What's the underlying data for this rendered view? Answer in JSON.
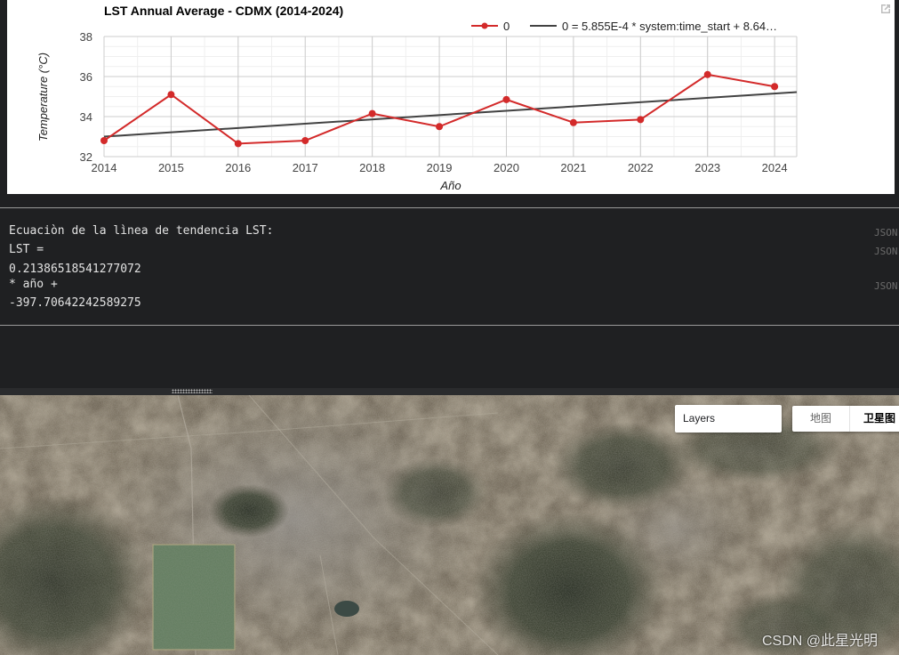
{
  "chart_data": {
    "type": "line",
    "title": "LST Annual Average - CDMX (2014-2024)",
    "xlabel": "Año",
    "ylabel": "Temperature (°C)",
    "x": [
      2014,
      2015,
      2016,
      2017,
      2018,
      2019,
      2020,
      2021,
      2022,
      2023,
      2024
    ],
    "xticks": [
      "2014",
      "2015",
      "2016",
      "2017",
      "2018",
      "2019",
      "2020",
      "2021",
      "2022",
      "2023",
      "2024"
    ],
    "yticks": [
      "32",
      "34",
      "36",
      "38"
    ],
    "ylim": [
      32,
      38
    ],
    "xlim": [
      2014,
      2024.33
    ],
    "grid": true,
    "legend_position": "top-right",
    "series": [
      {
        "name": "0",
        "values": [
          32.8,
          35.1,
          32.65,
          32.8,
          34.15,
          33.5,
          34.85,
          33.7,
          33.85,
          36.1,
          35.5
        ],
        "color": "#d32a2a",
        "markers": true
      },
      {
        "name": "0 = 5.855E-4 * system:time_start + 8.64…",
        "trendline": {
          "x": [
            2014,
            2024.33
          ],
          "y": [
            33.0,
            35.22
          ]
        },
        "color": "#424242",
        "markers": false
      }
    ]
  },
  "console": {
    "lines": [
      "Ecuaciòn de la lìnea de tendencia LST:",
      "LST =",
      "0.21386518541277072",
      "* año +",
      "-397.70642242589275"
    ],
    "json_tag": "JSON"
  },
  "map": {
    "layers_label": "Layers",
    "map_type_options": [
      "地图",
      "卫星图"
    ],
    "selected_map_type": "卫星图"
  },
  "watermark": "CSDN @此星光明",
  "colors": {
    "panel_bg": "#1f2022",
    "series_red": "#d32a2a",
    "trend_gray": "#424242"
  }
}
